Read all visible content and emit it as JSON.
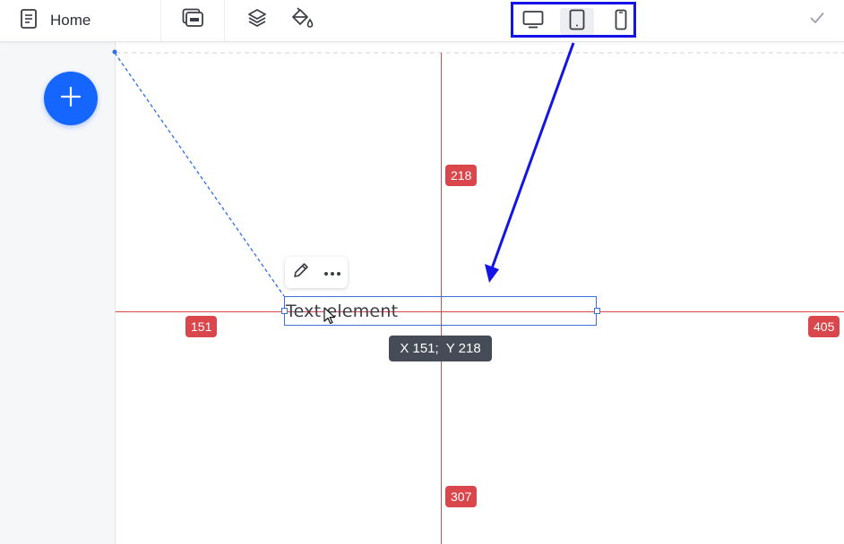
{
  "topbar": {
    "page_label": "Home",
    "icons": {
      "page": "page-icon",
      "blocks": "blocks-icon",
      "layers": "layers-icon",
      "theme": "paint-bucket-icon",
      "confirm": "checkmark-icon"
    },
    "devices": [
      {
        "name": "desktop",
        "icon": "desktop-icon",
        "active": false
      },
      {
        "name": "tablet",
        "icon": "tablet-icon",
        "active": true
      },
      {
        "name": "mobile",
        "icon": "mobile-icon",
        "active": false
      }
    ]
  },
  "leftpanel": {
    "add_icon": "plus-icon"
  },
  "canvas": {
    "text_element_label": "Text element",
    "distances": {
      "top": "218",
      "left": "151",
      "right": "405",
      "bottom": "307"
    },
    "coordinates_tooltip": "X 151;  Y 218",
    "element_toolbar": {
      "edit_icon": "pencil-icon",
      "more_icon": "more-dots-icon"
    }
  },
  "colors": {
    "accent": "#1565ff",
    "guide_red": "#d9464b",
    "selection_blue": "#3b6fd6",
    "annotation_blue": "#1414e6",
    "tooltip_bg": "#454b57"
  }
}
